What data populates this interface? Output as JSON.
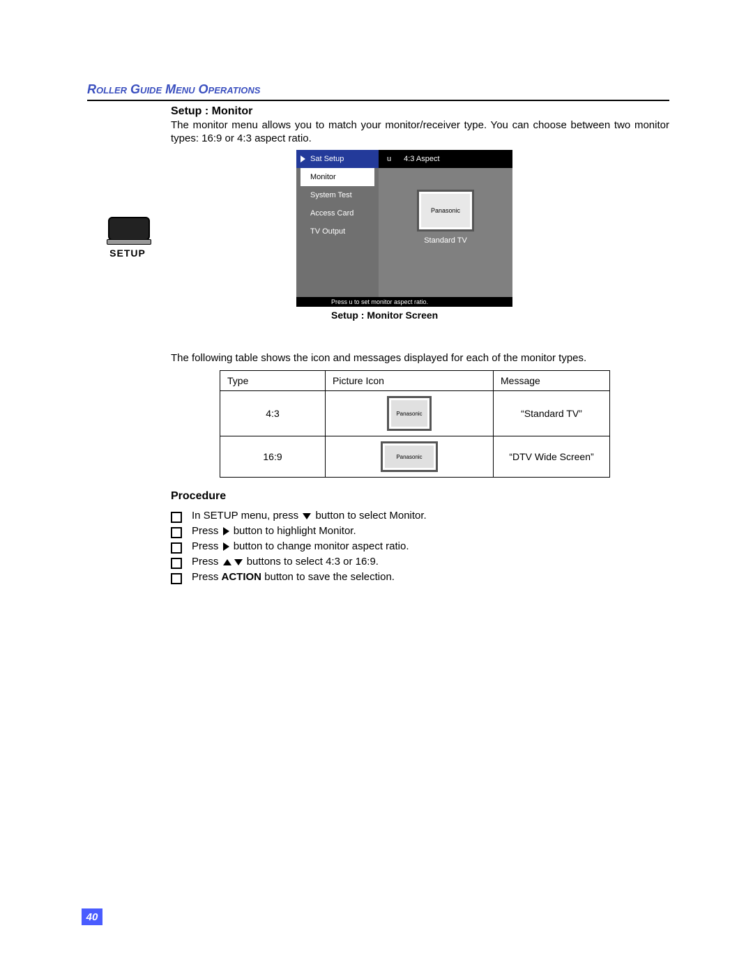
{
  "header": "Roller Guide Menu Operations",
  "section": {
    "title": "Setup : Monitor",
    "intro": "The monitor menu allows you to match your monitor/receiver type. You can choose between two monitor types: 16:9 or 4:3 aspect ratio.",
    "caption": "Setup : Monitor Screen",
    "table_intro": "The following table shows the icon and messages displayed for each of the monitor types."
  },
  "setup_icon_label": "SETUP",
  "screenshot": {
    "menu_items": [
      "Sat Setup",
      "Monitor",
      "System Test",
      "Access Card",
      "TV Output"
    ],
    "top_left_indicator": "u",
    "top_right": "4:3 Aspect",
    "tv_brand": "Panasonic",
    "tv_caption": "Standard TV",
    "help_text": "Press u  to set monitor aspect ratio."
  },
  "table": {
    "headers": [
      "Type",
      "Picture Icon",
      "Message"
    ],
    "rows": [
      {
        "type": "4:3",
        "brand": "Panasonic",
        "message": "“Standard TV”"
      },
      {
        "type": "16:9",
        "brand": "Panasonic",
        "message": "“DTV Wide Screen”"
      }
    ]
  },
  "procedure": {
    "title": "Procedure",
    "steps": {
      "s1a": "In SETUP menu, press ",
      "s1b": " button to select Monitor.",
      "s2a": "Press ",
      "s2b": " button to highlight Monitor.",
      "s3a": "Press ",
      "s3b": " button to change monitor aspect ratio.",
      "s4a": "Press  ",
      "s4b": " buttons to select 4:3 or 16:9.",
      "s5a": "Press ",
      "s5b": "ACTION",
      "s5c": " button to save the selection."
    }
  },
  "page_number": "40"
}
